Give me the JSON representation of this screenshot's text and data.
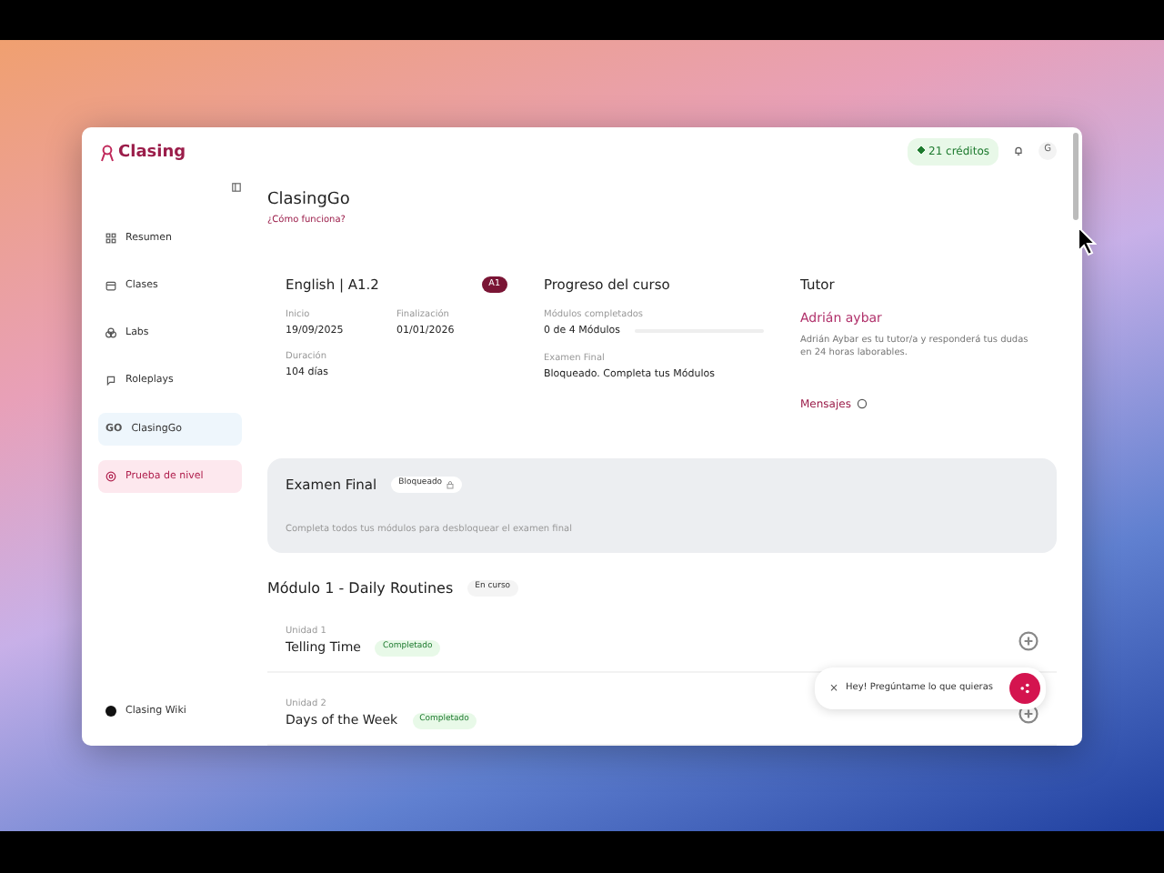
{
  "logo": {
    "text": "Clasing"
  },
  "sidebar": {
    "items": [
      {
        "label": "Resumen",
        "kind": "nav",
        "selected": false
      },
      {
        "label": "Clases",
        "kind": "nav",
        "selected": false
      },
      {
        "label": "Labs",
        "kind": "nav",
        "selected": false
      },
      {
        "label": "Roleplays",
        "kind": "nav",
        "selected": false
      },
      {
        "label": "ClasingGo",
        "kind": "nav",
        "icon_text": "GO",
        "selected": true
      },
      {
        "label": "Prueba de nivel",
        "kind": "promo",
        "selected": false
      }
    ],
    "footer": "Clasing Wiki"
  },
  "header": {
    "credits": "21 créditos",
    "avatar": "G"
  },
  "page": {
    "title": "ClasingGo",
    "help_link": "¿Cómo funciona?"
  },
  "course": {
    "title": "English | A1.2",
    "level": "A1",
    "fields": [
      {
        "label": "Inicio",
        "value": "19/09/2025"
      },
      {
        "label": "Finalización",
        "value": "01/01/2026"
      },
      {
        "label": "Duración",
        "value": "104 días"
      }
    ]
  },
  "progress": {
    "title": "Progreso del curso",
    "items": [
      {
        "label": "Módulos completados",
        "value": "0 de 4 Módulos",
        "kind": "bar",
        "level": 0
      },
      {
        "label": "Examen Final",
        "value": "Bloqueado. Completa tus Módulos",
        "kind": "text"
      }
    ]
  },
  "tutor": {
    "title": "Tutor",
    "name": "Adrián aybar",
    "description": "Adrián Aybar es tu tutor/a y responderá tus dudas en 24 horas laborables.",
    "messages_link": "Mensajes"
  },
  "exam": {
    "title": "Examen Final",
    "status": "Bloqueado",
    "locked": true,
    "note": "Completa todos tus módulos para desbloquear el examen final"
  },
  "module": {
    "title": "Módulo 1 - Daily Routines",
    "status": "En curso",
    "units": [
      {
        "label": "Unidad 1",
        "title": "Telling Time",
        "status": "Completado"
      },
      {
        "label": "Unidad 2",
        "title": "Days of the Week",
        "status": "Completado"
      }
    ]
  },
  "chat": {
    "close": "×",
    "prompt": "Hey! Pregúntame lo que quieras"
  }
}
